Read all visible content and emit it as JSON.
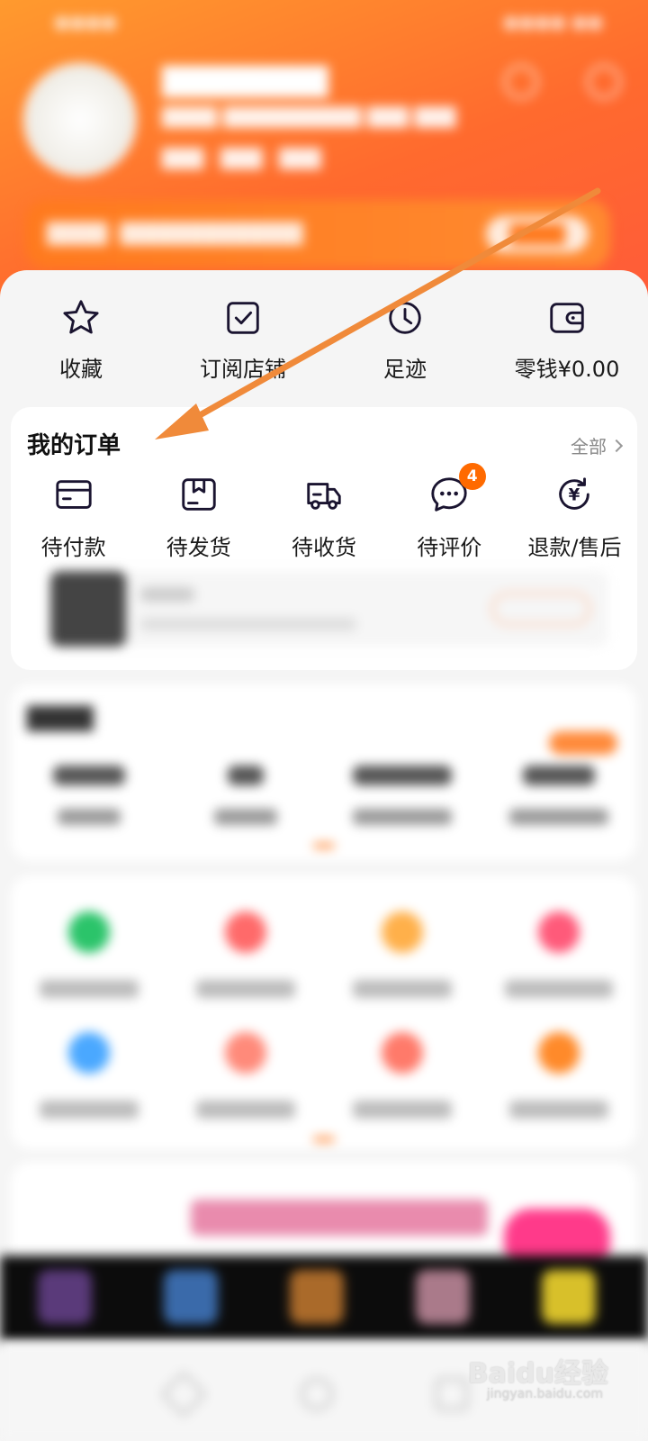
{
  "quick_access": [
    {
      "label": "收藏",
      "icon": "star-icon"
    },
    {
      "label": "订阅店铺",
      "icon": "check-square-icon"
    },
    {
      "label": "足迹",
      "icon": "clock-icon"
    },
    {
      "label": "零钱¥0.00",
      "icon": "wallet-icon"
    }
  ],
  "orders": {
    "title": "我的订单",
    "all_label": "全部",
    "items": [
      {
        "label": "待付款",
        "icon": "card-icon"
      },
      {
        "label": "待发货",
        "icon": "box-icon"
      },
      {
        "label": "待收货",
        "icon": "truck-icon"
      },
      {
        "label": "待评价",
        "icon": "chat-bubble-icon",
        "badge": "4"
      },
      {
        "label": "退款/售后",
        "icon": "yen-refund-icon"
      }
    ]
  },
  "watermark": {
    "brand": "Baidu经验",
    "url": "jingyan.baidu.com"
  },
  "colors": {
    "accent": "#ff7a1e",
    "arrow": "#f08a3a",
    "badge": "#ff6a00"
  }
}
